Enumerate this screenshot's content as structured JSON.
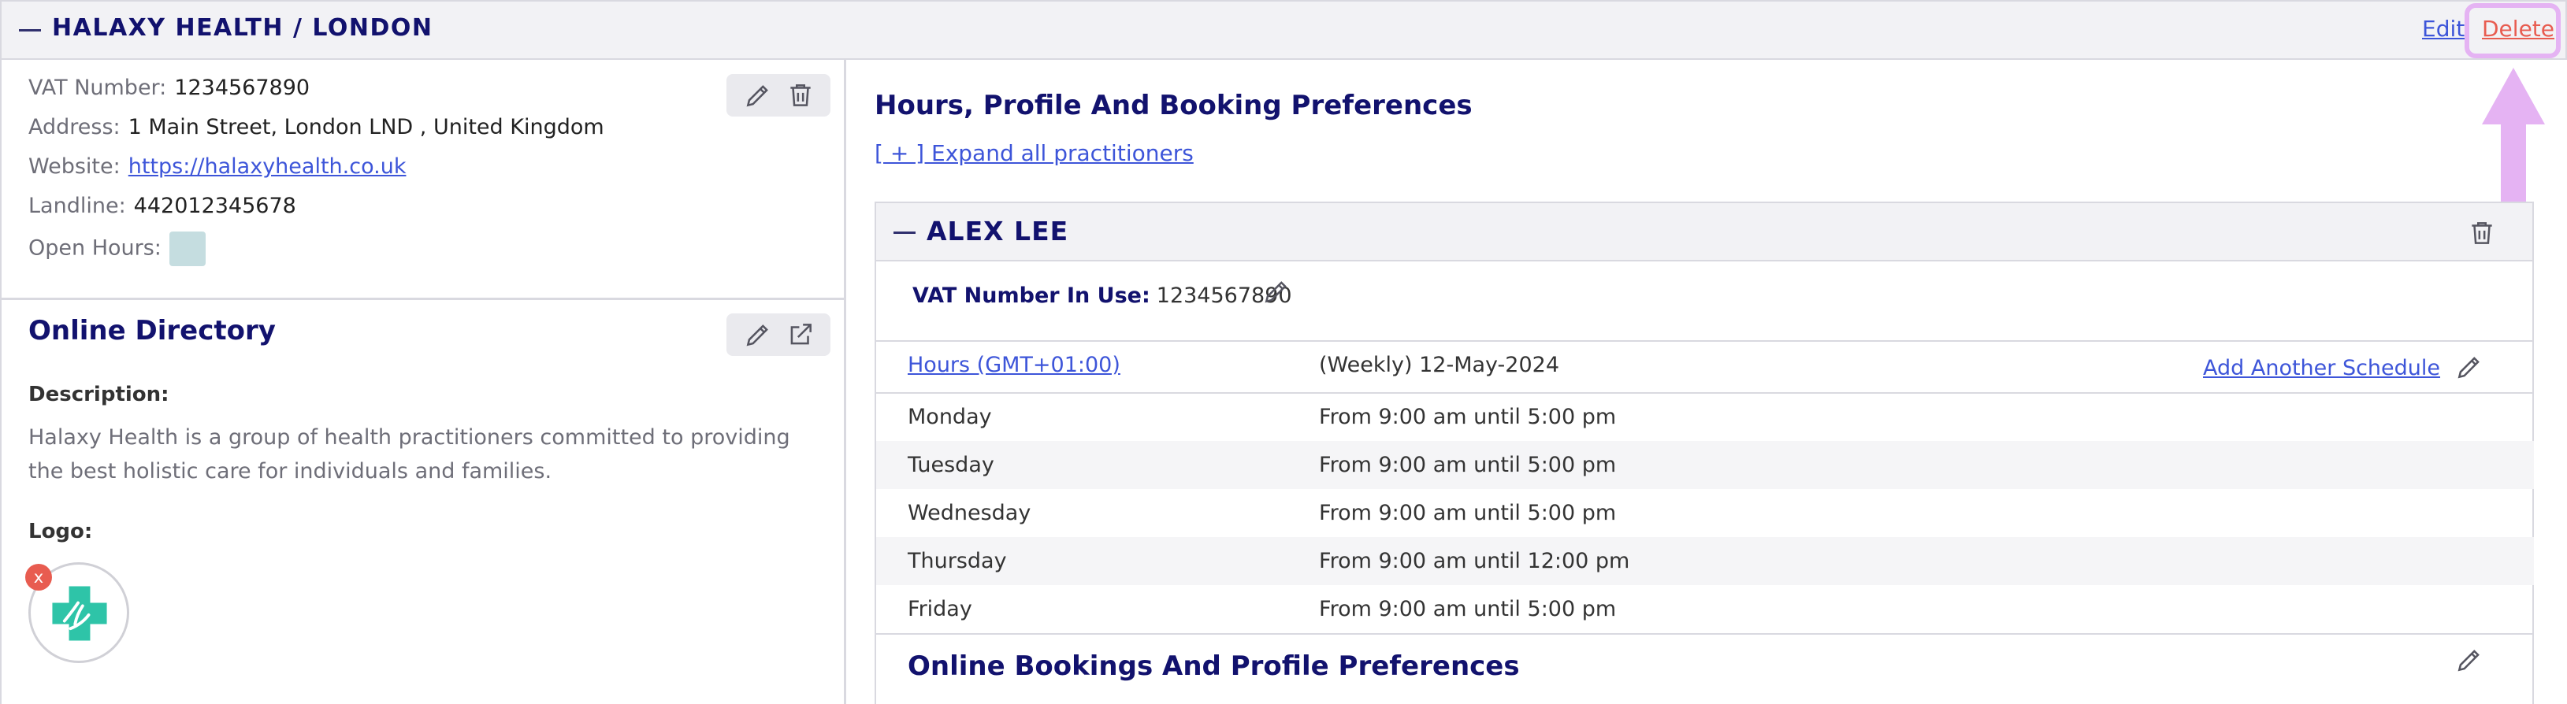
{
  "header": {
    "title": "HALAXY HEALTH / LONDON",
    "edit_label": "Edit",
    "delete_label": "Delete"
  },
  "details": {
    "vat_label": "VAT Number:",
    "vat_value": "1234567890",
    "address_label": "Address:",
    "address_value": "1 Main Street, London LND , United Kingdom",
    "website_label": "Website:",
    "website_value": "https://halaxyhealth.co.uk",
    "landline_label": "Landline:",
    "landline_value": "442012345678",
    "open_hours_label": "Open Hours:"
  },
  "directory": {
    "title": "Online Directory",
    "description_label": "Description:",
    "description_text": "Halaxy Health is a group of health practitioners committed to providing the best holistic care for individuals and families.",
    "logo_label": "Logo:",
    "logo_remove": "x"
  },
  "preferences": {
    "title": "Hours, Profile And Booking Preferences",
    "expand_label": "[ + ] Expand all practitioners"
  },
  "practitioner": {
    "name": "ALEX LEE",
    "vat_in_use_label": "VAT Number In Use:",
    "vat_in_use_value": "1234567890",
    "hours_link": "Hours (GMT+01:00)",
    "schedule_label": "(Weekly) 12-May-2024",
    "add_schedule_label": "Add Another Schedule",
    "schedule": [
      {
        "day": "Monday",
        "hours": "From 9:00 am until 5:00 pm"
      },
      {
        "day": "Tuesday",
        "hours": "From 9:00 am until 5:00 pm"
      },
      {
        "day": "Wednesday",
        "hours": "From 9:00 am until 5:00 pm"
      },
      {
        "day": "Thursday",
        "hours": "From 9:00 am until 12:00 pm"
      },
      {
        "day": "Friday",
        "hours": "From 9:00 am until 5:00 pm"
      }
    ],
    "online_bookings_title": "Online Bookings And Profile Preferences"
  },
  "colors": {
    "title_navy": "#12126e",
    "link_blue": "#3d55d9",
    "delete_red": "#e85c50",
    "highlight_lavender": "#e5b3f3",
    "logo_teal": "#2ec4a8"
  },
  "icons": [
    "pencil-icon",
    "trash-icon",
    "external-link-icon",
    "collapse-icon",
    "medical-cross-logo"
  ]
}
